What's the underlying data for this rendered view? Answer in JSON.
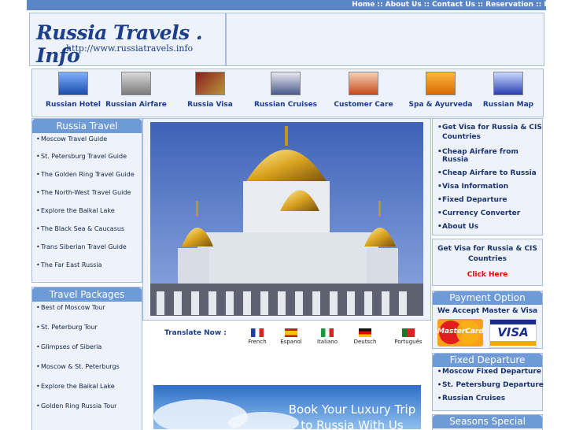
{
  "topnav": {
    "items": [
      "Home",
      "About Us",
      "Contact Us",
      "Reservation",
      "Email"
    ],
    "separator": "::"
  },
  "logo": {
    "title": "Russia Travels . Info",
    "url": "http://www.russiatravels.info"
  },
  "icons": [
    {
      "label": "Russian Hotel",
      "icon": "hotel-icon"
    },
    {
      "label": "Russian Airfare",
      "icon": "airplane-icon"
    },
    {
      "label": "Russia Visa",
      "icon": "passport-icon"
    },
    {
      "label": "Russian Cruises",
      "icon": "cruise-ship-icon"
    },
    {
      "label": "Customer Care",
      "icon": "headset-icon"
    },
    {
      "label": "Spa & Ayurveda",
      "icon": "spa-icon"
    },
    {
      "label": "Russian Map",
      "icon": "map-icon"
    }
  ],
  "russia_travel": {
    "heading": "Russia Travel",
    "items": [
      "Moscow Travel Guide",
      "St. Petersburg Travel Guide",
      "The Golden Ring Travel Guide",
      "The North-West Travel Guide",
      "Explore the Baikal Lake",
      "The Black Sea & Caucasus",
      "Trans Siberian Travel Guide",
      "The Far East Russia"
    ]
  },
  "travel_packages": {
    "heading": "Travel Packages",
    "items": [
      "Best of Moscow Tour",
      "St. Peterburg Tour",
      "Glimpses of Siberia",
      "Moscow & St. Peterburgs",
      "Explore the Baikal Lake",
      "Golden Ring Russia Tour"
    ]
  },
  "right_links": {
    "items": [
      "Get Visa for Russia & CIS Countries",
      "Cheap Airfare from Russia",
      "Cheap Airfare to Russia",
      "Visa Information",
      "Fixed Departure",
      "Currency Converter",
      "About Us"
    ]
  },
  "visa_box": {
    "text": "Get Visa for Russia & CIS Countries",
    "link": "Click Here"
  },
  "payment": {
    "heading": "Payment Option",
    "text": "We Accept Master & Visa",
    "card1": "MasterCard",
    "card2": "VISA"
  },
  "fixed_departure": {
    "heading": "Fixed Departure",
    "items": [
      "Moscow Fixed Departure",
      "St. Petersburg Departure",
      "Russian Cruises"
    ]
  },
  "seasons": {
    "heading": "Seasons Special"
  },
  "translate": {
    "label": "Translate Now :",
    "languages": [
      "French",
      "Espanol",
      "Italiano",
      "Deutsch",
      "Português"
    ]
  },
  "banner": {
    "text_line1": "Book Your Luxury Trip",
    "text_line2": "to Russia With Us"
  }
}
